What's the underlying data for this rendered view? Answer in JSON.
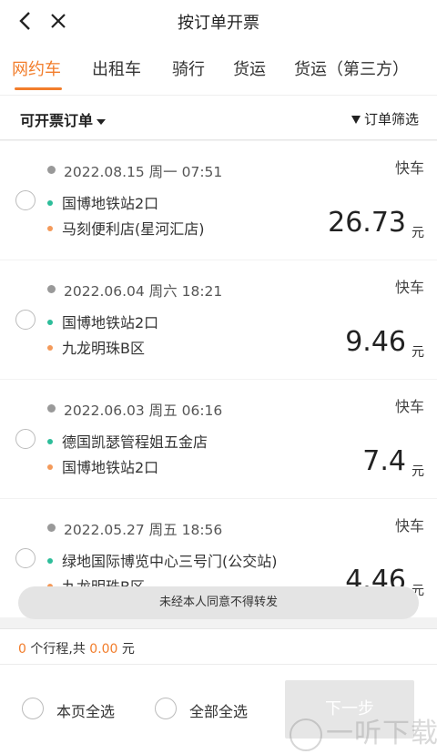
{
  "header": {
    "title": "按订单开票"
  },
  "tabs": [
    {
      "label": "网约车",
      "active": true
    },
    {
      "label": "出租车",
      "active": false
    },
    {
      "label": "骑行",
      "active": false
    },
    {
      "label": "货运",
      "active": false
    },
    {
      "label": "货运（第三方）",
      "active": false
    }
  ],
  "filter": {
    "left_label": "可开票订单",
    "right_label": "订单筛选"
  },
  "orders": [
    {
      "datetime": "2022.08.15 周一 07:51",
      "type": "快车",
      "from": "国博地铁站2口",
      "to": "马刻便利店(星河汇店)",
      "price": "26.73",
      "unit": "元"
    },
    {
      "datetime": "2022.06.04 周六 18:21",
      "type": "快车",
      "from": "国博地铁站2口",
      "to": "九龙明珠B区",
      "price": "9.46",
      "unit": "元"
    },
    {
      "datetime": "2022.06.03 周五 06:16",
      "type": "快车",
      "from": "德国凯瑟管程姐五金店",
      "to": "国博地铁站2口",
      "price": "7.4",
      "unit": "元"
    },
    {
      "datetime": "2022.05.27 周五 18:56",
      "type": "快车",
      "from": "绿地国际博览中心三号门(公交站)",
      "to": "九龙明珠B区",
      "price": "4.46",
      "unit": "元"
    }
  ],
  "toast": "未经本人同意不得转发",
  "summary": {
    "trip_count": "0",
    "trips_text": "个行程,共",
    "amount": "0.00",
    "currency": "元"
  },
  "footer": {
    "select_page": "本页全选",
    "select_all": "全部全选",
    "next": "下一步"
  },
  "watermark": "一听下载",
  "colors": {
    "accent": "#f27d2b",
    "start_dot": "#2dbd9a",
    "end_dot": "#f49a5a"
  }
}
